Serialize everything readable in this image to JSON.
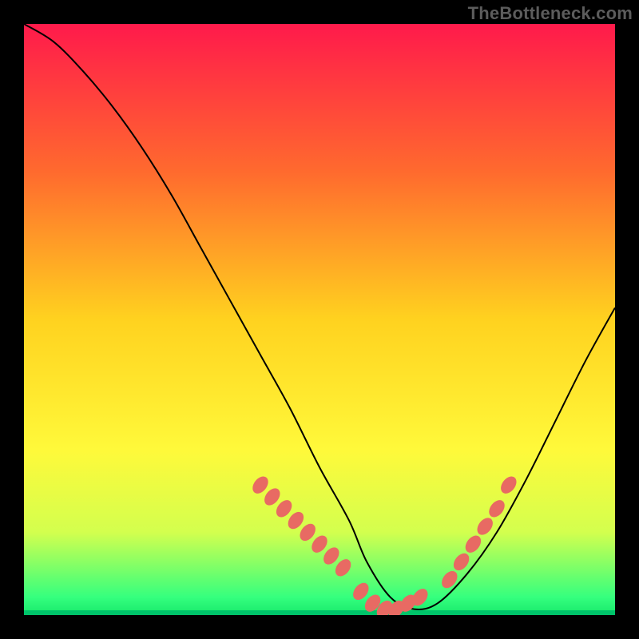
{
  "watermark": "TheBottleneck.com",
  "chart_data": {
    "type": "line",
    "title": "",
    "xlabel": "",
    "ylabel": "",
    "xlim": [
      0,
      100
    ],
    "ylim": [
      0,
      100
    ],
    "grid": false,
    "legend": false,
    "background_gradient": {
      "stops": [
        {
          "offset": 0.0,
          "color": "#ff1a4b"
        },
        {
          "offset": 0.25,
          "color": "#ff6a2e"
        },
        {
          "offset": 0.5,
          "color": "#ffd21f"
        },
        {
          "offset": 0.72,
          "color": "#fff93a"
        },
        {
          "offset": 0.86,
          "color": "#d3ff4e"
        },
        {
          "offset": 0.97,
          "color": "#35ff7e"
        },
        {
          "offset": 1.0,
          "color": "#17e86b"
        }
      ]
    },
    "curve": {
      "x": [
        0,
        5,
        10,
        15,
        20,
        25,
        30,
        35,
        40,
        45,
        50,
        55,
        58,
        62,
        66,
        70,
        75,
        80,
        85,
        90,
        95,
        100
      ],
      "y": [
        100,
        97,
        92,
        86,
        79,
        71,
        62,
        53,
        44,
        35,
        25,
        16,
        9,
        3,
        1,
        2,
        7,
        14,
        23,
        33,
        43,
        52
      ]
    },
    "band": {
      "start_y": 22,
      "end_y": 0
    },
    "markers": {
      "left_run": {
        "x": [
          40,
          42,
          44,
          46,
          48,
          50,
          52,
          54
        ],
        "y": [
          22,
          20,
          18,
          16,
          14,
          12,
          10,
          8
        ]
      },
      "valley": {
        "x": [
          57,
          59,
          61,
          63,
          65,
          67
        ],
        "y": [
          4,
          2,
          1,
          1,
          2,
          3
        ]
      },
      "right_run": {
        "x": [
          72,
          74,
          76,
          78,
          80,
          82
        ],
        "y": [
          6,
          9,
          12,
          15,
          18,
          22
        ]
      }
    },
    "bottom_bar": {
      "color": "#00c46a",
      "height_pct": 0.8
    }
  }
}
